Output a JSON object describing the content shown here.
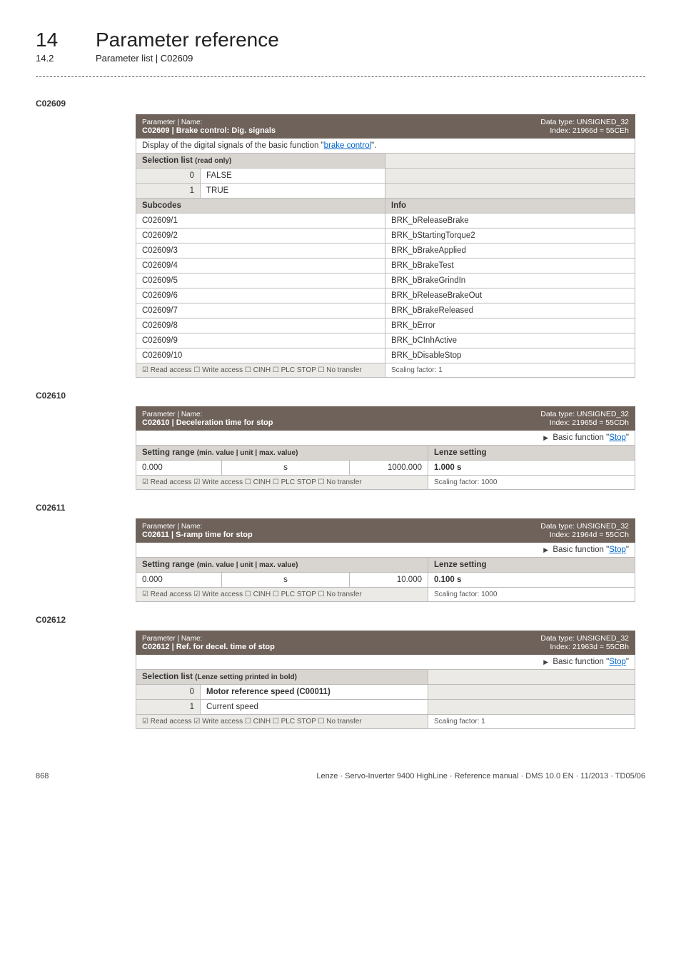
{
  "header": {
    "chapter_num": "14",
    "chapter_title": "Parameter reference",
    "sub_num": "14.2",
    "sub_title": "Parameter list | C02609"
  },
  "sections": [
    {
      "code": "C02609",
      "titlebar_left_prefix": "Parameter | Name:",
      "titlebar_left_main": "C02609 | Brake control: Dig. signals",
      "titlebar_right_l1": "Data type: UNSIGNED_32",
      "titlebar_right_l2": "Index: 21966d = 55CEh",
      "desc_pre": "Display of the digital signals of the basic function \"",
      "desc_link": "brake control",
      "desc_post": "\".",
      "selection_header": "Selection list (read only)",
      "selection_rows": [
        {
          "num": "0",
          "label": "FALSE"
        },
        {
          "num": "1",
          "label": "TRUE"
        }
      ],
      "subcodes_header_left": "Subcodes",
      "subcodes_header_right": "Info",
      "subcode_rows": [
        {
          "left": "C02609/1",
          "right": "BRK_bReleaseBrake"
        },
        {
          "left": "C02609/2",
          "right": "BRK_bStartingTorque2"
        },
        {
          "left": "C02609/3",
          "right": "BRK_bBrakeApplied"
        },
        {
          "left": "C02609/4",
          "right": "BRK_bBrakeTest"
        },
        {
          "left": "C02609/5",
          "right": "BRK_bBrakeGrindIn"
        },
        {
          "left": "C02609/6",
          "right": "BRK_bReleaseBrakeOut"
        },
        {
          "left": "C02609/7",
          "right": "BRK_bBrakeReleased"
        },
        {
          "left": "C02609/8",
          "right": "BRK_bError"
        },
        {
          "left": "C02609/9",
          "right": "BRK_bCInhActive"
        },
        {
          "left": "C02609/10",
          "right": "BRK_bDisableStop"
        }
      ],
      "foot_left": "☑ Read access   ☐ Write access   ☐ CINH   ☐ PLC STOP   ☐ No transfer",
      "foot_right": "Scaling factor: 1"
    },
    {
      "code": "C02610",
      "titlebar_left_prefix": "Parameter | Name:",
      "titlebar_left_main": "C02610 | Deceleration time for stop",
      "titlebar_right_l1": "Data type: UNSIGNED_32",
      "titlebar_right_l2": "Index: 21965d = 55CDh",
      "basic_func_pre": "Basic function \"",
      "basic_func_link": "Stop",
      "basic_func_post": "\"",
      "range_header_left": "Setting range (min. value | unit | max. value)",
      "range_header_right": "Lenze setting",
      "range_row": {
        "min": "0.000",
        "unit": "s",
        "max": "1000.000",
        "setting": "1.000 s"
      },
      "foot_left": "☑ Read access   ☑ Write access   ☐ CINH   ☐ PLC STOP   ☐ No transfer",
      "foot_right": "Scaling factor: 1000"
    },
    {
      "code": "C02611",
      "titlebar_left_prefix": "Parameter | Name:",
      "titlebar_left_main": "C02611 | S-ramp time for stop",
      "titlebar_right_l1": "Data type: UNSIGNED_32",
      "titlebar_right_l2": "Index: 21964d = 55CCh",
      "basic_func_pre": "Basic function \"",
      "basic_func_link": "Stop",
      "basic_func_post": "\"",
      "range_header_left": "Setting range (min. value | unit | max. value)",
      "range_header_right": "Lenze setting",
      "range_row": {
        "min": "0.000",
        "unit": "s",
        "max": "10.000",
        "setting": "0.100 s"
      },
      "foot_left": "☑ Read access   ☑ Write access   ☐ CINH   ☐ PLC STOP   ☐ No transfer",
      "foot_right": "Scaling factor: 1000"
    },
    {
      "code": "C02612",
      "titlebar_left_prefix": "Parameter | Name:",
      "titlebar_left_main": "C02612 | Ref. for decel. time of stop",
      "titlebar_right_l1": "Data type: UNSIGNED_32",
      "titlebar_right_l2": "Index: 21963d = 55CBh",
      "basic_func_pre": "Basic function \"",
      "basic_func_link": "Stop",
      "basic_func_post": "\"",
      "selection_header": "Selection list (Lenze setting printed in bold)",
      "selection_rows": [
        {
          "num": "0",
          "label": "Motor reference speed (C00011)",
          "bold": true
        },
        {
          "num": "1",
          "label": "Current speed"
        }
      ],
      "foot_left": "☑ Read access   ☑ Write access   ☐ CINH   ☐ PLC STOP   ☐ No transfer",
      "foot_right": "Scaling factor: 1"
    }
  ],
  "footer": {
    "page": "868",
    "doc": "Lenze · Servo-Inverter 9400 HighLine · Reference manual · DMS 10.0 EN · 11/2013 · TD05/06"
  }
}
